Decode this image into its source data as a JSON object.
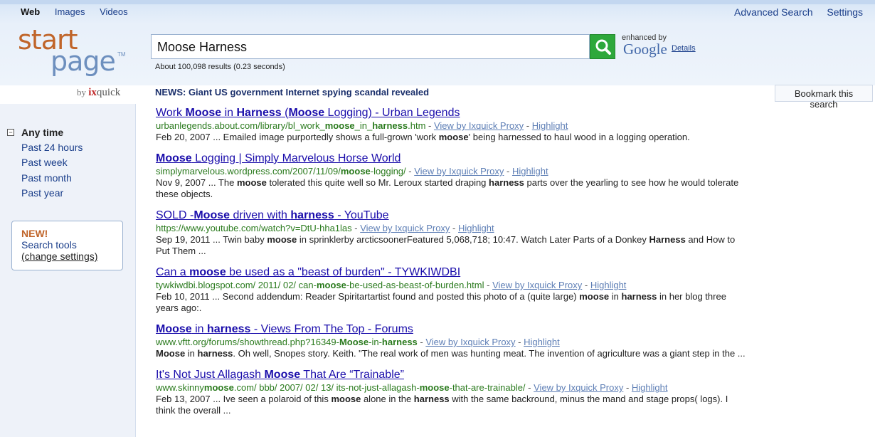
{
  "nav": {
    "web": "Web",
    "images": "Images",
    "videos": "Videos",
    "advanced_search": "Advanced Search",
    "settings": "Settings"
  },
  "logo": {
    "start": "start",
    "page": "page",
    "tm": "TM",
    "by": "by",
    "ix": "ix",
    "quick": "quick"
  },
  "search": {
    "query": "Moose Harness",
    "result_count": "About 100,098 results (0.23 seconds)",
    "enhanced_by": "enhanced by",
    "google": "Google",
    "details": "Details",
    "button_icon": "magnifier-icon"
  },
  "news": {
    "headline": "NEWS: Giant US government Internet spying scandal revealed",
    "bookmark": "Bookmark this search"
  },
  "sidebar": {
    "any_time": "Any time",
    "time_filters": [
      "Past 24 hours",
      "Past week",
      "Past month",
      "Past year"
    ],
    "tools_new": "NEW!",
    "tools_label": "Search tools",
    "tools_change": "(change settings)"
  },
  "result_links": {
    "proxy": "View by Ixquick Proxy",
    "highlight": "Highlight",
    "separator": " - "
  },
  "results": [
    {
      "title": [
        [
          "Work ",
          false
        ],
        [
          "Moose",
          true
        ],
        [
          " in ",
          false
        ],
        [
          "Harness",
          true
        ],
        [
          " (",
          false
        ],
        [
          "Moose",
          true
        ],
        [
          " Logging) - Urban Legends",
          false
        ]
      ],
      "url": [
        [
          "urbanlegends.about.com/library/bl_work_",
          false
        ],
        [
          "moose",
          true
        ],
        [
          "_in_",
          false
        ],
        [
          "harness",
          true
        ],
        [
          ".htm",
          false
        ]
      ],
      "snippet": [
        [
          "Feb 20, 2007 ... Emailed image purportedly shows a full-grown 'work ",
          false
        ],
        [
          "moose",
          true
        ],
        [
          "' being harnessed to haul wood in a logging operation.",
          false
        ]
      ]
    },
    {
      "title": [
        [
          "Moose",
          true
        ],
        [
          " Logging | Simply Marvelous Horse World",
          false
        ]
      ],
      "url": [
        [
          "simplymarvelous.wordpress.com/2007/11/09/",
          false
        ],
        [
          "moose",
          true
        ],
        [
          "-logging/",
          false
        ]
      ],
      "snippet": [
        [
          "Nov 9, 2007 ... The ",
          false
        ],
        [
          "moose",
          true
        ],
        [
          " tolerated this quite well so Mr. Leroux started draping ",
          false
        ],
        [
          "harness",
          true
        ],
        [
          " parts over the yearling to see how he would tolerate these objects.",
          false
        ]
      ]
    },
    {
      "title": [
        [
          "SOLD -",
          false
        ],
        [
          "Moose",
          true
        ],
        [
          " driven with ",
          false
        ],
        [
          "harness",
          true
        ],
        [
          " - YouTube",
          false
        ]
      ],
      "url": [
        [
          "https://www.youtube.com/watch?v=DtU-hha1las",
          false
        ]
      ],
      "snippet": [
        [
          "Sep 19, 2011 ... Twin baby ",
          false
        ],
        [
          "moose",
          true
        ],
        [
          " in sprinklerby arcticsoonerFeatured 5,068,718; 10:47. Watch Later Parts of a Donkey ",
          false
        ],
        [
          "Harness",
          true
        ],
        [
          " and How to Put Them ...",
          false
        ]
      ]
    },
    {
      "title": [
        [
          "Can a ",
          false
        ],
        [
          "moose",
          true
        ],
        [
          " be used as a \"beast of burden\" - TYWKIWDBI",
          false
        ]
      ],
      "url": [
        [
          "tywkiwdbi.blogspot.com/ 2011/ 02/ can-",
          false
        ],
        [
          "moose",
          true
        ],
        [
          "-be-used-as-beast-of-burden.html",
          false
        ]
      ],
      "snippet": [
        [
          "Feb 10, 2011 ... Second addendum: Reader Spiritartartist found and posted this photo of a (quite large) ",
          false
        ],
        [
          "moose",
          true
        ],
        [
          " in ",
          false
        ],
        [
          "harness",
          true
        ],
        [
          " in her blog three years ago:.",
          false
        ]
      ]
    },
    {
      "title": [
        [
          "Moose",
          true
        ],
        [
          " in ",
          false
        ],
        [
          "harness",
          true
        ],
        [
          " - Views From The Top - Forums",
          false
        ]
      ],
      "url": [
        [
          "www.vftt.org/forums/showthread.php?16349-",
          false
        ],
        [
          "Moose",
          true
        ],
        [
          "-in-",
          false
        ],
        [
          "harness",
          true
        ]
      ],
      "snippet": [
        [
          "Moose",
          true
        ],
        [
          " in ",
          false
        ],
        [
          "harness",
          true
        ],
        [
          ". Oh well, Snopes story. Keith. \"The real work of men was hunting meat. The invention of agriculture was a giant step in the ...",
          false
        ]
      ]
    },
    {
      "title": [
        [
          "It's Not Just Allagash ",
          false
        ],
        [
          "Moose",
          true
        ],
        [
          " That Are “Trainable”",
          false
        ]
      ],
      "url": [
        [
          "www.skinny",
          false
        ],
        [
          "moose",
          true
        ],
        [
          ".com/ bbb/ 2007/ 02/ 13/ its-not-just-allagash-",
          false
        ],
        [
          "moose",
          true
        ],
        [
          "-that-are-trainable/",
          false
        ]
      ],
      "snippet": [
        [
          "Feb 13, 2007 ... Ive seen a polaroid of this ",
          false
        ],
        [
          "moose",
          true
        ],
        [
          " alone in the ",
          false
        ],
        [
          "harness",
          true
        ],
        [
          " with the same backround, minus the mand and stage props( logs). I think the overall ...",
          false
        ]
      ]
    }
  ],
  "colors": {
    "link": "#1a0dab",
    "url": "#2a7a1d",
    "search_button": "#2ea83b",
    "logo_orange": "#c0652a",
    "logo_blue": "#6d8fbe"
  }
}
